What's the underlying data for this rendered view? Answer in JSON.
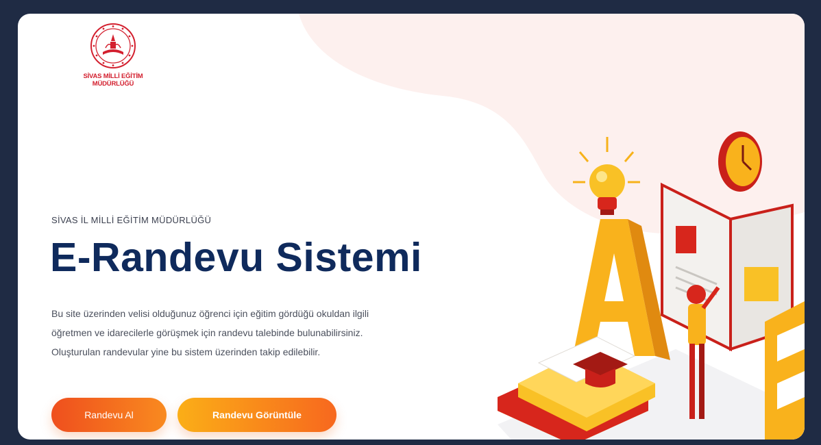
{
  "header": {
    "logo_text": "SİVAS MİLLİ EĞİTİM\nMÜDÜRLÜĞÜ"
  },
  "hero": {
    "eyebrow": "SİVAS İL MİLLİ EĞİTİM MÜDÜRLÜĞÜ",
    "title": "E-Randevu Sistemi",
    "description_lines": [
      "Bu site üzerinden velisi olduğunuz öğrenci için eğitim gördüğü okuldan ilgili",
      "öğretmen ve idarecilerle görüşmek için randevu talebinde bulunabilirsiniz.",
      "Oluşturulan randevular yine bu sistem üzerinden takip edilebilir."
    ]
  },
  "actions": {
    "appointment_label": "Randevu Al",
    "view_label": "Randevu Görüntüle"
  },
  "colors": {
    "page_background": "#1f2b44",
    "title": "#0f2a5c",
    "brand_red": "#d3202f",
    "blob": "#fdf0ee",
    "orange": "#f7681e",
    "yellow": "#fbae17"
  },
  "icons": {
    "logo": "ministry-emblem-icon",
    "illustration": "education-isometric-illustration"
  }
}
